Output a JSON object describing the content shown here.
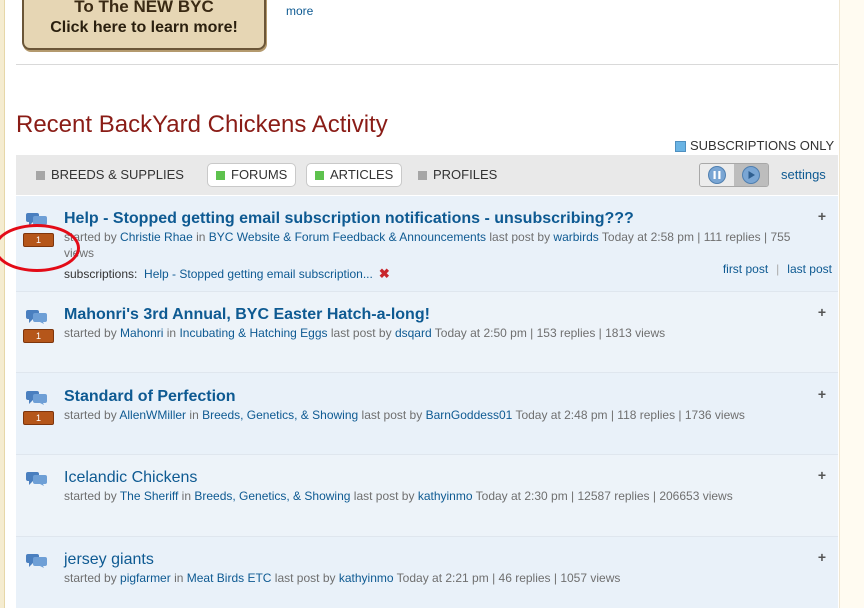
{
  "promo": {
    "line1": "To The NEW BYC",
    "line2": "Click here to learn more!",
    "more": "more"
  },
  "page_title": "Recent BackYard Chickens Activity",
  "subscriptions_only": "SUBSCRIPTIONS ONLY",
  "tabs": [
    {
      "label": "BREEDS & SUPPLIES",
      "active": false
    },
    {
      "label": "FORUMS",
      "active": true
    },
    {
      "label": "ARTICLES",
      "active": true
    },
    {
      "label": "PROFILES",
      "active": false
    }
  ],
  "settings": "settings",
  "threads": [
    {
      "title": "Help - Stopped getting email subscription notifications - unsubscribing???",
      "badge": "1",
      "started_by_label": "started by",
      "author": "Christie Rhae",
      "in_label": "in",
      "forum": "BYC Website & Forum Feedback & Announcements",
      "last_post_label": "last post by",
      "last_poster": "warbirds",
      "stats": "Today at 2:58 pm | 111 replies | 755 views",
      "subscriptions_label": "subscriptions:",
      "subscriptions_value": "Help - Stopped getting email subscription...",
      "first_post": "first post",
      "last_post": "last post"
    },
    {
      "title": "Mahonri's 3rd Annual, BYC Easter Hatch-a-long!",
      "badge": "1",
      "started_by_label": "started by",
      "author": "Mahonri",
      "in_label": "in",
      "forum": "Incubating & Hatching Eggs",
      "last_post_label": "last post by",
      "last_poster": "dsqard",
      "stats": "Today at 2:50 pm | 153 replies | 1813 views"
    },
    {
      "title": "Standard of Perfection",
      "badge": "1",
      "started_by_label": "started by",
      "author": "AllenWMiller",
      "in_label": "in",
      "forum": "Breeds, Genetics, & Showing",
      "last_post_label": "last post by",
      "last_poster": "BarnGoddess01",
      "stats": "Today at 2:48 pm | 118 replies | 1736 views"
    },
    {
      "title": "Icelandic Chickens",
      "started_by_label": "started by",
      "author": "The Sheriff",
      "in_label": "in",
      "forum": "Breeds, Genetics, & Showing",
      "last_post_label": "last post by",
      "last_poster": "kathyinmo",
      "stats": "Today at 2:30 pm | 12587 replies | 206653 views"
    },
    {
      "title": "jersey giants",
      "started_by_label": "started by",
      "author": "pigfarmer",
      "in_label": "in",
      "forum": "Meat Birds ETC",
      "last_post_label": "last post by",
      "last_poster": "kathyinmo",
      "stats": "Today at 2:21 pm | 46 replies | 1057 views"
    }
  ],
  "colors": {
    "title": "#8a1c16",
    "link": "#0e5a92",
    "badge": "#b5561a",
    "annotation_circle": "#e30b17"
  }
}
